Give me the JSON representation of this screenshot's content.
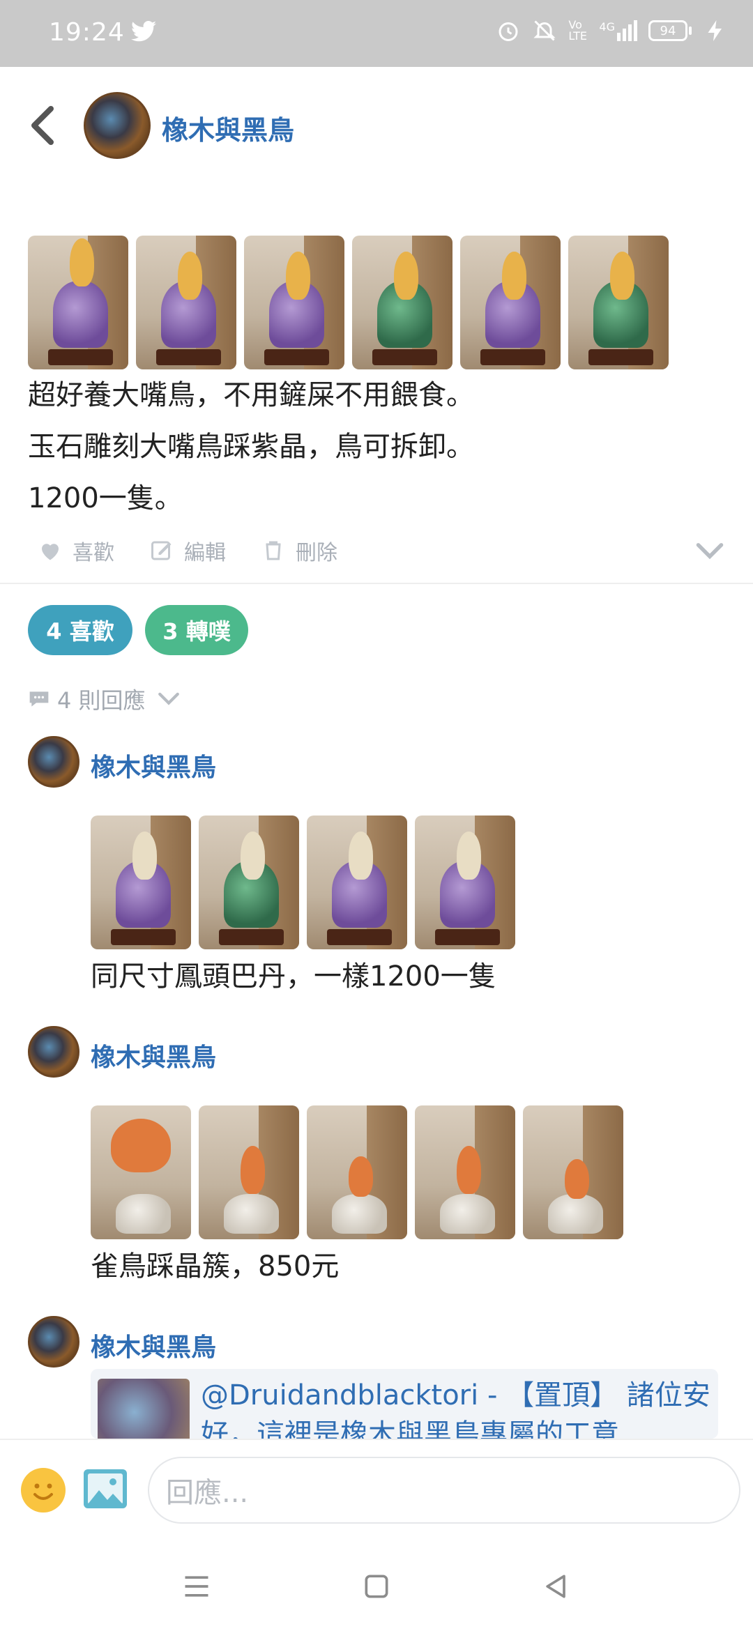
{
  "status_bar": {
    "time": "19:24",
    "icons": [
      "twitter-icon",
      "alarm-icon",
      "mute-icon",
      "volte-icon",
      "signal-4g-icon",
      "battery-icon",
      "charging-icon"
    ],
    "network": "4G",
    "volte": "Vo LTE",
    "battery": "94"
  },
  "header": {
    "back_icon": "back-arrow-icon",
    "author": "橡木與黑鳥"
  },
  "post": {
    "lines": [
      "超好養大嘴鳥，不用鏟屎不用餵食。",
      "玉石雕刻大嘴鳥踩紫晶，鳥可拆卸。",
      "1200一隻。"
    ],
    "actions": {
      "like": "喜歡",
      "edit": "編輯",
      "delete": "刪除"
    }
  },
  "stats": {
    "likes": "4 喜歡",
    "shares": "3 轉噗"
  },
  "replies_header": "4 則回應",
  "comments": [
    {
      "author": "橡木與黑鳥",
      "text": "同尺寸鳳頭巴丹，一樣1200一隻"
    },
    {
      "author": "橡木與黑鳥",
      "text": "雀鳥踩晶簇，850元"
    },
    {
      "author": "橡木與黑鳥",
      "text": "@Druidandblacktori - 【置頂】 諸位安好，這裡是橡木與黑鳥專屬的工意"
    }
  ],
  "reply_bar": {
    "placeholder": "回應..."
  },
  "colors": {
    "link": "#2f6db3",
    "like_pill": "#3fa1bd",
    "share_pill": "#4cb98c",
    "status_bar": "#c9c9c9"
  }
}
